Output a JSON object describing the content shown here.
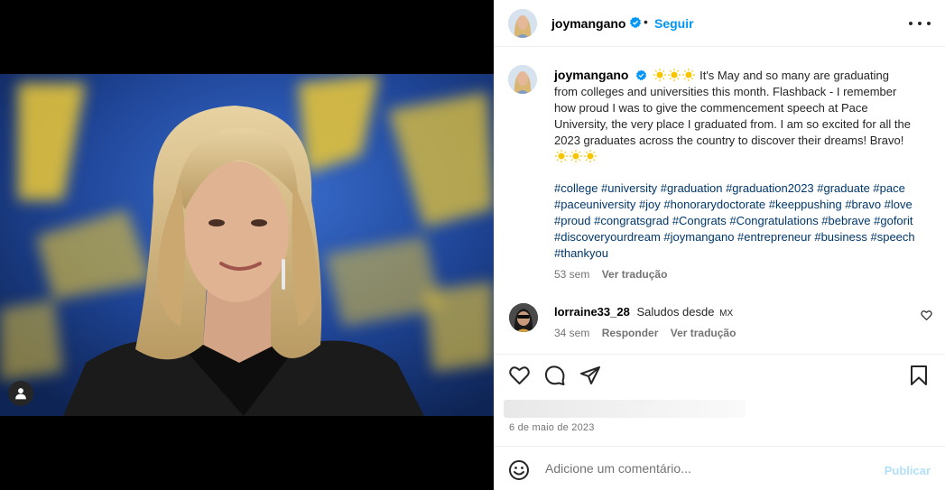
{
  "post": {
    "author": "joymangano",
    "follow_label": "Seguir",
    "dot": "•",
    "caption_text": "It's May and so many are graduating from colleges and universities this month. Flashback - I remember how proud I was to give the commencement speech at Pace University, the very place I graduated from. I am so excited for all the 2023 graduates across the country to discover their dreams! Bravo!",
    "hashtags": "#college #university #graduation #graduation2023 #graduate #pace #paceuniversity #joy #honorarydoctorate #keeppushing #bravo #love #proud #congratsgrad #Congrats #Congratulations #bebrave #goforit #discoveryourdream #joymangano #entrepreneur #business #speech #thankyou",
    "caption_age": "53 sem",
    "translate_label": "Ver tradução",
    "date": "6 de maio de 2023"
  },
  "comment": {
    "author": "lorraine33_28",
    "text": "Saludos desde",
    "flag_text": "MX",
    "age": "34 sem",
    "reply_label": "Responder",
    "translate_label": "Ver tradução"
  },
  "composer": {
    "placeholder": "Adicione um comentário...",
    "publish_label": "Publicar"
  },
  "icons": {
    "verified": "verified-badge-icon",
    "more": "more-options-icon",
    "like": "heart-icon",
    "comment": "comment-icon",
    "share": "share-icon",
    "save": "bookmark-icon",
    "emoji": "emoji-icon",
    "tag": "user-tag-icon",
    "sun": "sun-emoji-icon"
  },
  "colors": {
    "link": "#0095f6",
    "hashtag": "#00376b",
    "muted": "#737373",
    "publish_disabled": "#b2dffc"
  }
}
